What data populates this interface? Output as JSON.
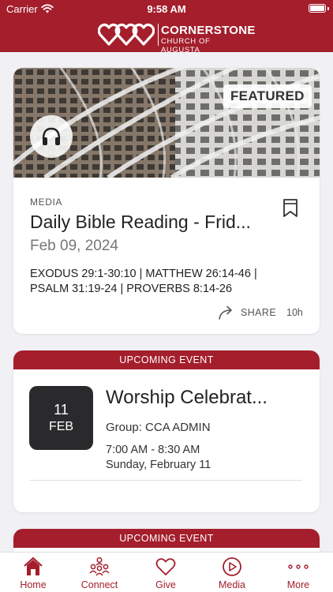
{
  "status_bar": {
    "carrier": "Carrier",
    "time": "9:58 AM"
  },
  "header": {
    "logo_name": "CORNERSTONE",
    "logo_subtitle": "CHURCH OF AUGUSTA"
  },
  "featured_card": {
    "badge": "FEATURED",
    "media_icon": "headphones-icon",
    "type": "MEDIA",
    "title": "Daily Bible Reading - Frid...",
    "date": "Feb 09, 2024",
    "description": "EXODUS 29:1-30:10 | MATTHEW 26:14-46 | PSALM 31:19-24 | PROVERBS 8:14-26",
    "share_label": "SHARE",
    "age": "10h"
  },
  "event_card": {
    "band_label": "UPCOMING EVENT",
    "day": "11",
    "month": "FEB",
    "title": "Worship Celebrat...",
    "group": "Group: CCA ADMIN",
    "time": "7:00 AM - 8:30 AM",
    "weekday_date": "Sunday, February 11"
  },
  "event_card_2": {
    "band_label": "UPCOMING EVENT"
  },
  "tab_bar": {
    "tabs": [
      {
        "label": "Home",
        "icon": "home-icon"
      },
      {
        "label": "Connect",
        "icon": "people-icon"
      },
      {
        "label": "Give",
        "icon": "heart-icon"
      },
      {
        "label": "Media",
        "icon": "play-icon"
      },
      {
        "label": "More",
        "icon": "more-icon"
      }
    ]
  },
  "colors": {
    "brand": "#a41e2c",
    "date_tile": "#2a2a2c",
    "background": "#f1f1f5"
  }
}
